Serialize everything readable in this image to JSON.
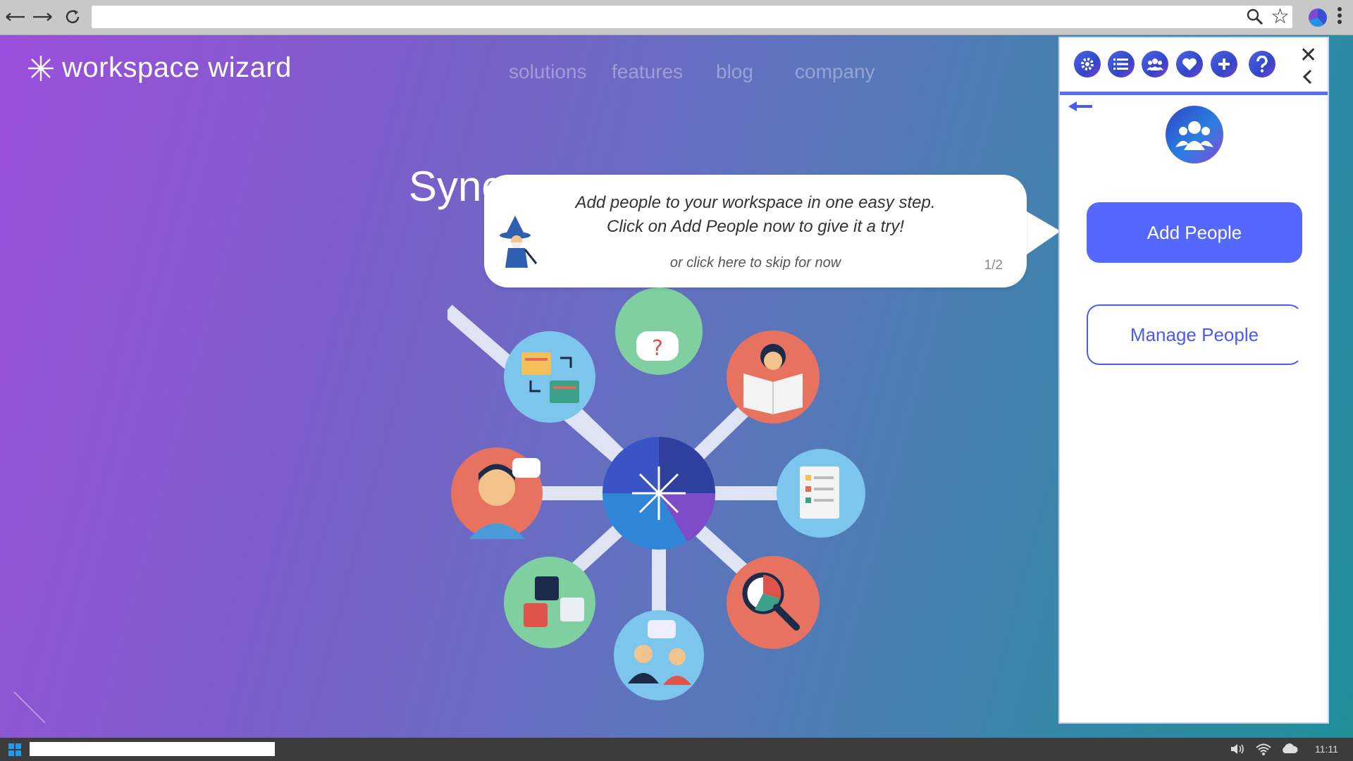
{
  "browser": {
    "url": "",
    "icons": [
      "back-arrow-icon",
      "forward-arrow-icon",
      "reload-icon",
      "search-icon",
      "star-icon",
      "profile-icon",
      "menu-icon"
    ]
  },
  "site": {
    "logo_text": "workspace wizard",
    "nav": [
      "solutions",
      "features",
      "blog",
      "company"
    ],
    "hero_title": "Sync"
  },
  "tooltip": {
    "line1": "Add people to your workspace in one easy step.",
    "line2": "Click on Add People now to give it a try!",
    "skip": "or click here to skip for now",
    "counter": "1/2"
  },
  "panel": {
    "toolbar_icons": [
      "settings-icon",
      "list-icon",
      "people-icon",
      "heart-icon",
      "plus-icon",
      "help-icon"
    ],
    "add_people_label": "Add People",
    "manage_people_label": "Manage People"
  },
  "taskbar": {
    "time": "11:11"
  },
  "colors": {
    "panel_accent": "#5468ff",
    "gradient_start": "#9b4fdc",
    "gradient_end": "#1f8f9a"
  }
}
